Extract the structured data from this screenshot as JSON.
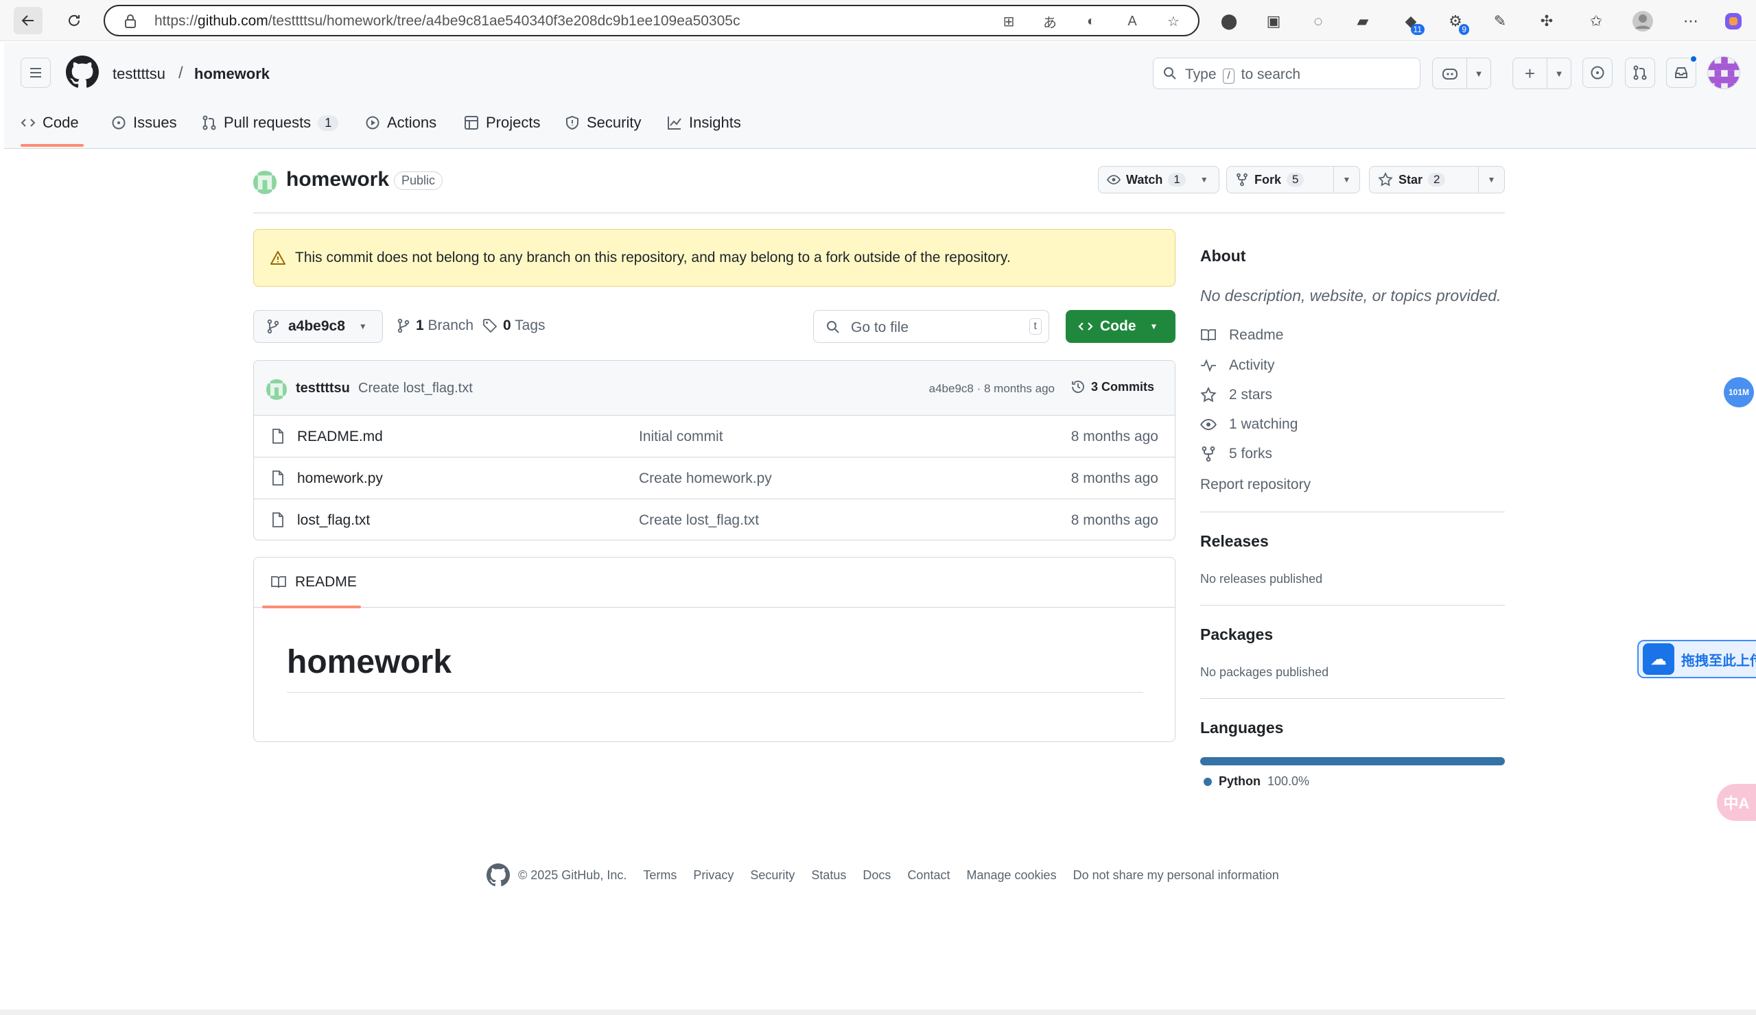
{
  "browser": {
    "url_prefix": "https://",
    "url_host": "github.com",
    "url_path": "/testtttsu/homework/tree/a4be9c81ae540340f3e208dc9b1ee109ea50305c",
    "extension_badges": [
      "11",
      "9"
    ]
  },
  "header": {
    "owner": "testtttsu",
    "separator": "/",
    "repo": "homework",
    "search_before": "Type",
    "search_key": "/",
    "search_after": "to search"
  },
  "tabs": [
    {
      "label": "Code",
      "icon": "code-icon"
    },
    {
      "label": "Issues",
      "icon": "issue-icon"
    },
    {
      "label": "Pull requests",
      "icon": "pull-request-icon",
      "count": "1"
    },
    {
      "label": "Actions",
      "icon": "play-icon"
    },
    {
      "label": "Projects",
      "icon": "table-icon"
    },
    {
      "label": "Security",
      "icon": "shield-icon"
    },
    {
      "label": "Insights",
      "icon": "graph-icon"
    }
  ],
  "repo": {
    "name": "homework",
    "visibility": "Public",
    "watch_label": "Watch",
    "watch_count": "1",
    "fork_label": "Fork",
    "fork_count": "5",
    "star_label": "Star",
    "star_count": "2"
  },
  "flash": {
    "message": "This commit does not belong to any branch on this repository, and may belong to a fork outside of the repository."
  },
  "filenav": {
    "branch": "a4be9c8",
    "branch_count": "1",
    "branch_label": "Branch",
    "tag_count": "0",
    "tag_label": "Tags",
    "goto_placeholder": "Go to file",
    "goto_key": "t",
    "code_label": "Code"
  },
  "latest_commit": {
    "author": "testtttsu",
    "message": "Create lost_flag.txt",
    "meta": "a4be9c8 · 8 months ago",
    "commits_label": "3 Commits"
  },
  "files": [
    {
      "name": "README.md",
      "commit": "Initial commit",
      "age": "8 months ago"
    },
    {
      "name": "homework.py",
      "commit": "Create homework.py",
      "age": "8 months ago"
    },
    {
      "name": "lost_flag.txt",
      "commit": "Create lost_flag.txt",
      "age": "8 months ago"
    }
  ],
  "readme": {
    "tab_label": "README",
    "heading": "homework"
  },
  "sidebar": {
    "about_title": "About",
    "about_desc": "No description, website, or topics provided.",
    "items": [
      {
        "label": "Readme",
        "icon": "book-icon"
      },
      {
        "label": "Activity",
        "icon": "pulse-icon"
      },
      {
        "label": "2 stars",
        "icon": "star-icon"
      },
      {
        "label": "1 watching",
        "icon": "eye-icon"
      },
      {
        "label": "5 forks",
        "icon": "fork-icon"
      }
    ],
    "report": "Report repository",
    "releases_title": "Releases",
    "releases_text": "No releases published",
    "packages_title": "Packages",
    "packages_text": "No packages published",
    "languages_title": "Languages",
    "language_name": "Python",
    "language_percent": "100.0%",
    "language_color": "#3572A5"
  },
  "footer": {
    "copyright": "© 2025 GitHub, Inc.",
    "links": [
      "Terms",
      "Privacy",
      "Security",
      "Status",
      "Docs",
      "Contact",
      "Manage cookies",
      "Do not share my personal information"
    ]
  },
  "widgets": {
    "meter": "101M",
    "upload": "拖拽至此上传",
    "translate": "中A"
  },
  "colors": {
    "accent_green": "#1f883d",
    "tab_underline": "#fd8c73",
    "flash_bg": "#fff8c5"
  }
}
